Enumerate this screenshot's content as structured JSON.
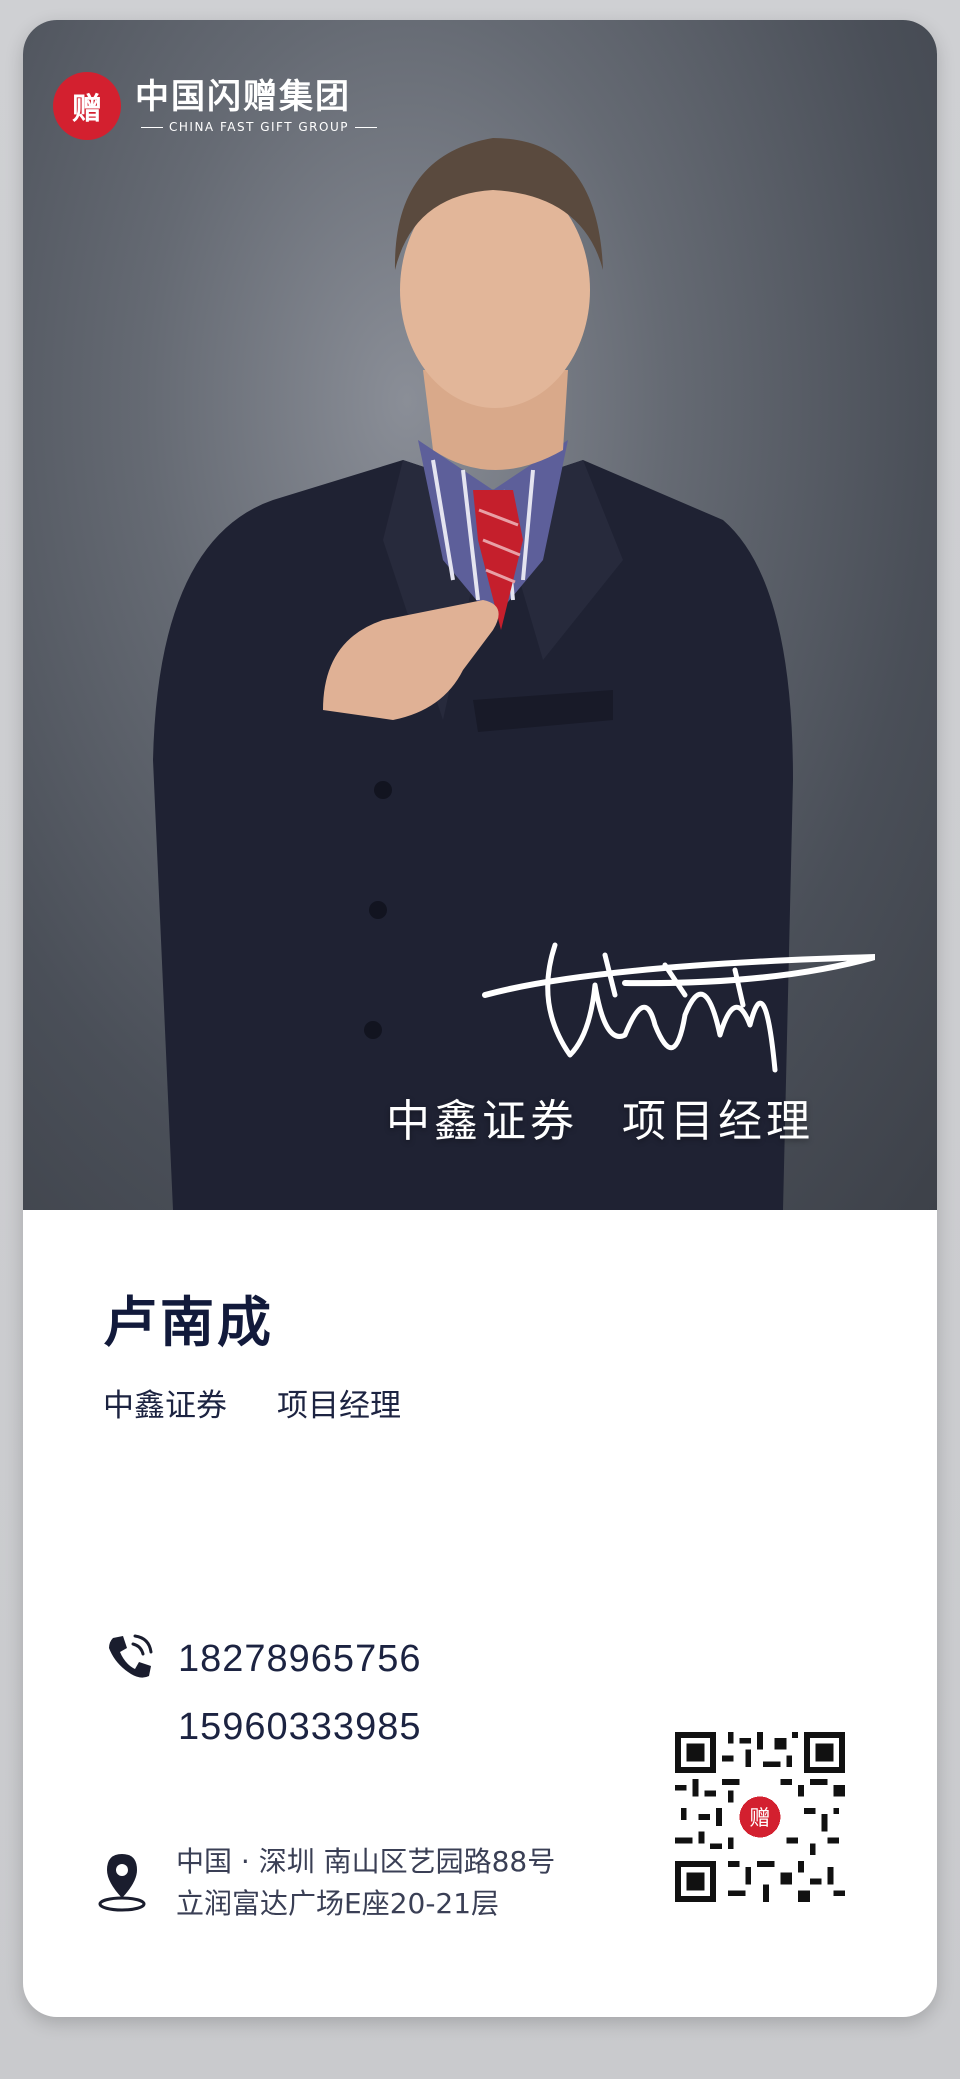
{
  "logo": {
    "mark_text": "赠",
    "name_cn": "中国闪赠集团",
    "name_en": "CHINA FAST GIFT GROUP"
  },
  "photo": {
    "caption_company": "中鑫证券",
    "caption_role": "项目经理"
  },
  "profile": {
    "name": "卢南成",
    "company": "中鑫证券",
    "role": "项目经理"
  },
  "contact": {
    "phone_icon": "phone-icon",
    "phones": [
      "18278965756",
      "15960333985"
    ],
    "location_icon": "location-pin-icon",
    "address_line1": "中国 · 深圳  南山区艺园路88号",
    "address_line2": "立润富达广场E座20-21层"
  },
  "qr": {
    "icon": "qr-code-icon",
    "center_mark": "赠"
  },
  "colors": {
    "brand_red": "#d3202f",
    "text_navy": "#121a3b",
    "photo_bg": "#5c616a"
  }
}
